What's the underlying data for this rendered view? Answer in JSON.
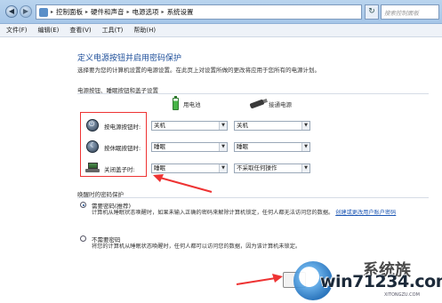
{
  "address_bar": {
    "crumbs": [
      "控制面板",
      "硬件和声音",
      "电源选项",
      "系统设置"
    ],
    "search_placeholder": "搜索控制面板"
  },
  "menu": [
    "文件(F)",
    "编辑(E)",
    "查看(V)",
    "工具(T)",
    "帮助(H)"
  ],
  "page": {
    "title": "定义电源按钮并启用密码保护",
    "subtitle": "选择要为您的计算机设置的电源设置。在此页上对设置所做的更改将应用于您所有的电源计划。"
  },
  "power_section": {
    "label": "电源按钮、睡眠按钮和盖子设置",
    "col_battery": "用电池",
    "col_plugged": "接通电源",
    "rows": [
      {
        "label": "按电源按钮时:",
        "battery": "关机",
        "plugged": "关机",
        "icon": "power-button-icon"
      },
      {
        "label": "按休眠按钮时:",
        "battery": "睡眠",
        "plugged": "睡眠",
        "icon": "sleep-button-icon"
      },
      {
        "label": "关闭盖子时:",
        "battery": "睡眠",
        "plugged": "不采取任何操作",
        "icon": "laptop-lid-icon"
      }
    ]
  },
  "password_section": {
    "label": "唤醒时的密码保护",
    "options": [
      {
        "title": "需要密码(推荐)",
        "desc": "计算机从睡眠状态唤醒时，如果未输入正确的密码来解除计算机锁定，任何人都无法访问您的数据。",
        "link": "创建或更改用户账户密码",
        "checked": true
      },
      {
        "title": "不需要密码",
        "desc": "将您的计算机从睡眠状态唤醒时，任何人都可以访问您的数据，因为该计算机未锁定。",
        "checked": false
      }
    ]
  },
  "watermark": {
    "text": "win71234.com",
    "brand": "系统族",
    "small": "XITONGZU.COM"
  },
  "colors": {
    "highlight_red": "#e33333",
    "title_blue": "#1e4f9a"
  }
}
